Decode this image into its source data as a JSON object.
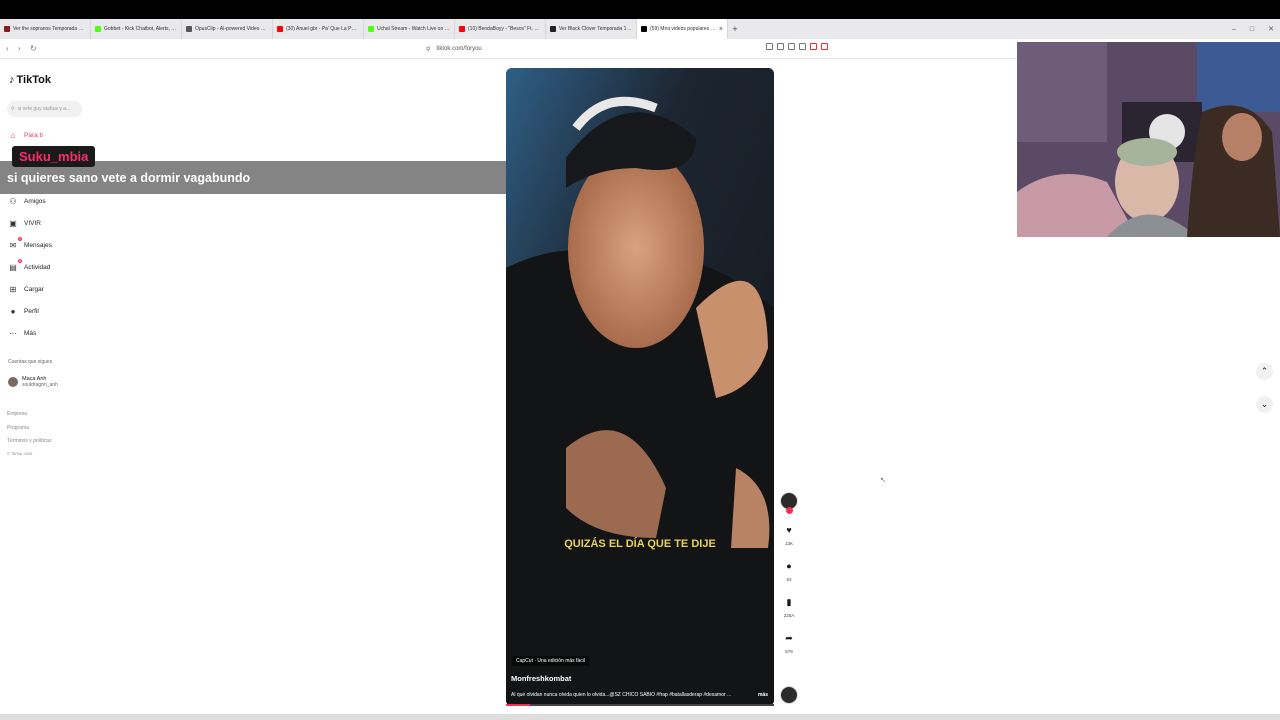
{
  "browser": {
    "tabs": [
      {
        "title": "Ver the sopranos Temporada 4 Ep...",
        "color": "#8a1c1c"
      },
      {
        "title": "Gobbet - Kick Chatbot, Alerts, TTS...",
        "color": "#53fc18"
      },
      {
        "title": "OpusClip - AI-powered Video Repur...",
        "color": "#555555"
      },
      {
        "title": "(30) Anuel gbr - Pa' Que La Pasas Bie...",
        "color": "#ff0000"
      },
      {
        "title": "Uchal Stream - Watch Live on Kick",
        "color": "#53fc18"
      },
      {
        "title": "(10) BendaBoyy - \"Besos\" Ft. Scaagg...",
        "color": "#ff0000"
      },
      {
        "title": "Ver Black Clover Temporada 1 Episo...",
        "color": "#222222"
      },
      {
        "title": "(59) Mira videos populares en...",
        "color": "#000000",
        "active": true
      }
    ],
    "new_tab": "+",
    "window_controls": [
      "–",
      "□",
      "✕"
    ],
    "url": "tiktok.com/foryou",
    "nav": {
      "back": "‹",
      "forward": "›",
      "reload": "↻"
    }
  },
  "sidebar": {
    "logo": "TikTok",
    "search_placeholder": "si vete guy atabus y a...",
    "items": [
      {
        "label": "Para ti",
        "icon": "home-icon",
        "glyph": "⌂",
        "active": true
      },
      {
        "label": "Amigos",
        "icon": "friends-icon",
        "glyph": "⚇"
      },
      {
        "label": "VIVIR",
        "icon": "live-icon",
        "glyph": "▣"
      },
      {
        "label": "Mensajes",
        "icon": "messages-icon",
        "glyph": "✉",
        "badge": "1"
      },
      {
        "label": "Actividad",
        "icon": "activity-icon",
        "glyph": "▤",
        "badge": "9"
      },
      {
        "label": "Cargar",
        "icon": "upload-icon",
        "glyph": "⊞"
      },
      {
        "label": "Perfil",
        "icon": "profile-icon",
        "glyph": "●"
      },
      {
        "label": "Más",
        "icon": "more-icon",
        "glyph": "⋯"
      }
    ],
    "following_title": "Cuentas que sigues",
    "following": {
      "name": "Maca Anh",
      "handle": "souldragon_anh"
    },
    "footer": [
      "Empresa",
      "Programa",
      "Términos y políticas",
      "© TikTok 2025"
    ]
  },
  "chat_overlay": {
    "username": "Suku_mbia",
    "message": "si quieres sano vete a dormir vagabundo"
  },
  "video": {
    "subtitle": "QUIZÁS EL DÍA QUE TE DIJE",
    "capcut_tag": "CapCut · Una edición más fácil",
    "author": "Monfreshkombat",
    "caption": "Al que olvidan nunca olvida quien lo olvida...@SZ CHICO SABIO #frap #batallasderap #desamor ...",
    "more": "más",
    "progress": 0.09
  },
  "actions": {
    "likes": "13K",
    "comments": "53",
    "saves": "225A",
    "shares": "579"
  },
  "scroll": {
    "up": "⌃",
    "down": "⌄"
  },
  "colors": {
    "accent": "#fe2c55"
  }
}
